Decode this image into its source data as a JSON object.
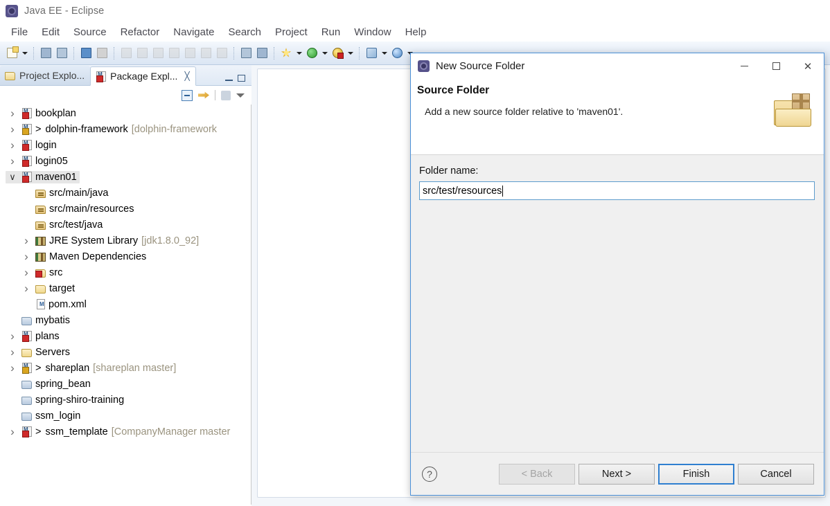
{
  "window": {
    "title": "Java EE - Eclipse",
    "app_icon": "eclipse-icon"
  },
  "menubar": {
    "items": [
      {
        "label": "File"
      },
      {
        "label": "Edit"
      },
      {
        "label": "Source"
      },
      {
        "label": "Refactor"
      },
      {
        "label": "Navigate"
      },
      {
        "label": "Search"
      },
      {
        "label": "Project"
      },
      {
        "label": "Run"
      },
      {
        "label": "Window"
      },
      {
        "label": "Help"
      }
    ]
  },
  "toolbar": {
    "items": [
      {
        "icon": "new-wizard-icon"
      },
      {
        "icon": "dropdown-arrow-icon"
      },
      {
        "icon": "save-icon"
      },
      {
        "icon": "save-all-icon"
      },
      {
        "icon": "separator"
      },
      {
        "icon": "console-icon"
      },
      {
        "icon": "skip-breakpoints-icon"
      },
      {
        "icon": "separator"
      },
      {
        "icon": "resume-icon"
      },
      {
        "icon": "suspend-icon"
      },
      {
        "icon": "terminate-icon"
      },
      {
        "icon": "disconnect-icon"
      },
      {
        "icon": "step-into-icon"
      },
      {
        "icon": "step-over-icon"
      },
      {
        "icon": "step-return-icon"
      },
      {
        "icon": "separator"
      },
      {
        "icon": "new-java-class-icon"
      },
      {
        "icon": "new-annotation-icon"
      },
      {
        "icon": "separator"
      },
      {
        "icon": "debug-icon"
      },
      {
        "icon": "dropdown-arrow-icon"
      },
      {
        "icon": "run-icon"
      },
      {
        "icon": "dropdown-arrow-icon"
      },
      {
        "icon": "run-server-icon"
      },
      {
        "icon": "dropdown-arrow-icon"
      },
      {
        "icon": "separator"
      },
      {
        "icon": "new-profile-icon"
      },
      {
        "icon": "dropdown-arrow-icon"
      },
      {
        "icon": "open-web-browser-icon"
      },
      {
        "icon": "dropdown-arrow-icon"
      }
    ]
  },
  "left_panel": {
    "tabs": [
      {
        "label": "Project Explo...",
        "icon": "project-explorer-icon",
        "active": false,
        "closable": false
      },
      {
        "label": "Package Expl...",
        "icon": "package-explorer-icon",
        "active": true,
        "closable": true,
        "close_glyph": "╳"
      }
    ],
    "window_controls": [
      {
        "icon": "minimize-view-icon"
      },
      {
        "icon": "maximize-view-icon"
      }
    ],
    "view_toolbar": [
      {
        "icon": "collapse-all-icon"
      },
      {
        "icon": "link-with-editor-icon"
      },
      {
        "icon": "separator"
      },
      {
        "icon": "focus-on-active-task-icon"
      },
      {
        "icon": "view-menu-icon"
      }
    ],
    "tree": [
      {
        "indent": 0,
        "twisty": "closed",
        "icon": "maven-project-icon",
        "label": "bookplan",
        "annotation": "",
        "git": false,
        "selected": false
      },
      {
        "indent": 0,
        "twisty": "closed",
        "icon": "maven-project-java-icon",
        "label": "dolphin-framework",
        "annotation": "[dolphin-framework",
        "git": true,
        "selected": false
      },
      {
        "indent": 0,
        "twisty": "closed",
        "icon": "maven-project-icon",
        "label": "login",
        "annotation": "",
        "git": false,
        "selected": false
      },
      {
        "indent": 0,
        "twisty": "closed",
        "icon": "maven-project-icon",
        "label": "login05",
        "annotation": "",
        "git": false,
        "selected": false
      },
      {
        "indent": 0,
        "twisty": "open",
        "icon": "maven-project-icon",
        "label": "maven01",
        "annotation": "",
        "git": false,
        "selected": true
      },
      {
        "indent": 1,
        "twisty": "none",
        "icon": "source-package-icon",
        "label": "src/main/java",
        "annotation": "",
        "git": false,
        "selected": false
      },
      {
        "indent": 1,
        "twisty": "none",
        "icon": "source-package-icon",
        "label": "src/main/resources",
        "annotation": "",
        "git": false,
        "selected": false
      },
      {
        "indent": 1,
        "twisty": "none",
        "icon": "source-package-icon",
        "label": "src/test/java",
        "annotation": "",
        "git": false,
        "selected": false
      },
      {
        "indent": 1,
        "twisty": "closed",
        "icon": "library-icon",
        "label": "JRE System Library",
        "annotation": "[jdk1.8.0_92]",
        "git": false,
        "selected": false
      },
      {
        "indent": 1,
        "twisty": "closed",
        "icon": "library-icon",
        "label": "Maven Dependencies",
        "annotation": "",
        "git": false,
        "selected": false
      },
      {
        "indent": 1,
        "twisty": "closed",
        "icon": "folder-error-icon",
        "label": "src",
        "annotation": "",
        "git": false,
        "selected": false
      },
      {
        "indent": 1,
        "twisty": "closed",
        "icon": "folder-icon",
        "label": "target",
        "annotation": "",
        "git": false,
        "selected": false
      },
      {
        "indent": 1,
        "twisty": "none",
        "icon": "xml-file-icon",
        "label": "pom.xml",
        "annotation": "",
        "git": false,
        "selected": false
      },
      {
        "indent": 0,
        "twisty": "none",
        "icon": "closed-project-icon",
        "label": "mybatis",
        "annotation": "",
        "git": false,
        "selected": false
      },
      {
        "indent": 0,
        "twisty": "closed",
        "icon": "maven-project-icon",
        "label": "plans",
        "annotation": "",
        "git": false,
        "selected": false
      },
      {
        "indent": 0,
        "twisty": "closed",
        "icon": "folder-icon",
        "label": "Servers",
        "annotation": "",
        "git": false,
        "selected": false
      },
      {
        "indent": 0,
        "twisty": "closed",
        "icon": "maven-project-java-icon",
        "label": "shareplan",
        "annotation": "[shareplan master]",
        "git": true,
        "selected": false
      },
      {
        "indent": 0,
        "twisty": "none",
        "icon": "closed-project-icon",
        "label": "spring_bean",
        "annotation": "",
        "git": false,
        "selected": false
      },
      {
        "indent": 0,
        "twisty": "none",
        "icon": "closed-project-icon",
        "label": "spring-shiro-training",
        "annotation": "",
        "git": false,
        "selected": false
      },
      {
        "indent": 0,
        "twisty": "none",
        "icon": "closed-project-icon",
        "label": "ssm_login",
        "annotation": "",
        "git": false,
        "selected": false
      },
      {
        "indent": 0,
        "twisty": "closed",
        "icon": "maven-project-icon",
        "label": "ssm_template",
        "annotation": "[CompanyManager master",
        "git": true,
        "selected": false
      }
    ],
    "git_prefix": ">"
  },
  "dialog": {
    "title": "New Source Folder",
    "icon": "eclipse-icon",
    "window_controls": {
      "minimize": "minimize-icon",
      "maximize": "maximize-icon",
      "close": "✕"
    },
    "header": {
      "title": "Source Folder",
      "description": "Add a new source folder relative to 'maven01'.",
      "banner_icon": "source-folder-banner-icon"
    },
    "form": {
      "folder_name_label": "Folder name:",
      "folder_name_value": "src/test/resources",
      "folder_name_placeholder": ""
    },
    "footer": {
      "help_label": "?",
      "buttons": [
        {
          "label": "< Back",
          "state": "disabled"
        },
        {
          "label": "Next >",
          "state": "enabled"
        },
        {
          "label": "Finish",
          "state": "default"
        },
        {
          "label": "Cancel",
          "state": "enabled"
        }
      ]
    }
  },
  "colors": {
    "accent": "#2f7fd0",
    "toolbar_bg": "#e4ecf6",
    "dialog_bg": "#f0f0f0",
    "selection": "#e6e6e6",
    "annotation_text": "#9a937f"
  }
}
